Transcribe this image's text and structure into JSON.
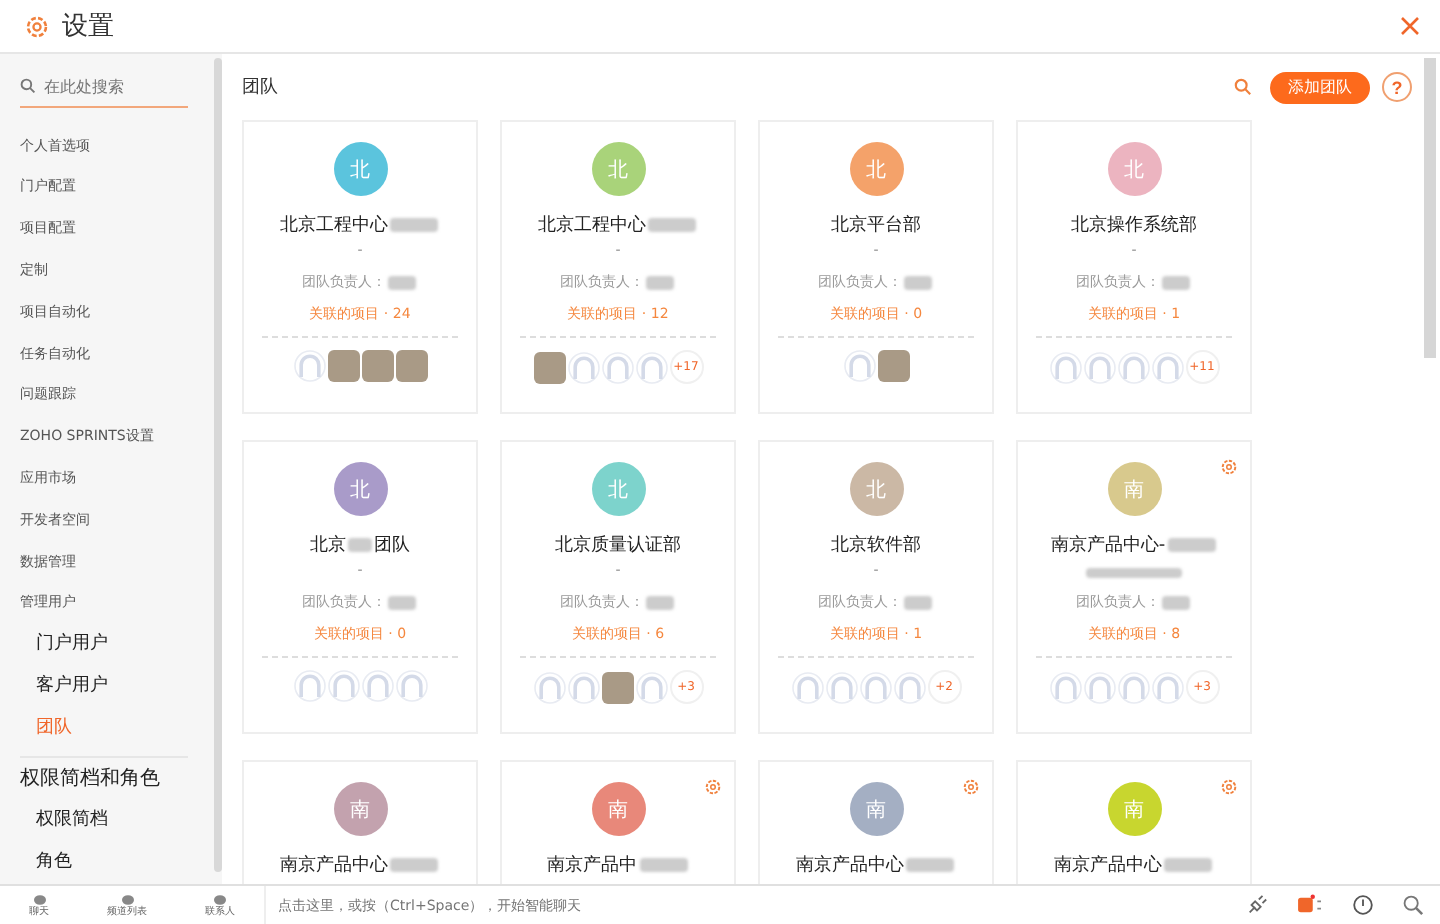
{
  "window": {
    "title": "设置"
  },
  "sidebar": {
    "search": {
      "placeholder": "在此处搜索"
    },
    "items": [
      {
        "kind": "item",
        "label": "个人首选项",
        "selected": false
      },
      {
        "kind": "item",
        "label": "门户配置",
        "selected": false
      },
      {
        "kind": "item",
        "label": "项目配置",
        "selected": false
      },
      {
        "kind": "item",
        "label": "定制",
        "selected": false
      },
      {
        "kind": "item",
        "label": "项目自动化",
        "selected": false
      },
      {
        "kind": "item",
        "label": "任务自动化",
        "selected": false
      },
      {
        "kind": "item",
        "label": "问题跟踪",
        "selected": false
      },
      {
        "kind": "item",
        "label": "ZOHO SPRINTS设置",
        "selected": false
      },
      {
        "kind": "item",
        "label": "应用市场",
        "selected": false
      },
      {
        "kind": "item",
        "label": "开发者空间",
        "selected": false
      },
      {
        "kind": "item",
        "label": "数据管理",
        "selected": false
      },
      {
        "kind": "item",
        "label": "管理用户",
        "selected": false
      },
      {
        "kind": "sub",
        "label": "门户用户",
        "selected": false
      },
      {
        "kind": "sub",
        "label": "客户用户",
        "selected": false
      },
      {
        "kind": "sub",
        "label": "团队",
        "selected": true
      },
      {
        "kind": "section",
        "label": "权限简档和角色",
        "selected": false
      },
      {
        "kind": "sub",
        "label": "权限简档",
        "selected": false
      },
      {
        "kind": "sub",
        "label": "角色",
        "selected": false
      }
    ]
  },
  "content": {
    "title": "团队",
    "add_button": "添加团队",
    "help_button": "?",
    "teams": [
      {
        "initial": "北",
        "color": "#5bc4dd",
        "name": "北京工程中心",
        "name_blurred": true,
        "description": "-",
        "leader_label": "团队负责人：",
        "projects": "关联的项目 · 24",
        "members": [
          {
            "kind": "empty"
          },
          {
            "kind": "photo"
          },
          {
            "kind": "photo"
          },
          {
            "kind": "photo"
          }
        ],
        "flagged": false
      },
      {
        "initial": "北",
        "color": "#a9d37a",
        "name": "北京工程中心",
        "name_blurred": true,
        "description": "-",
        "leader_label": "团队负责人：",
        "projects": "关联的项目 · 12",
        "members": [
          {
            "kind": "photo"
          },
          {
            "kind": "empty"
          },
          {
            "kind": "empty"
          },
          {
            "kind": "empty"
          }
        ],
        "more": "+17",
        "flagged": false
      },
      {
        "initial": "北",
        "color": "#f4a26a",
        "name": "北京平台部",
        "name_blurred": false,
        "description": "-",
        "leader_label": "团队负责人：",
        "projects": "关联的项目 · 0",
        "members": [
          {
            "kind": "empty"
          },
          {
            "kind": "photo"
          }
        ],
        "flagged": false
      },
      {
        "initial": "北",
        "color": "#ecb4c0",
        "name": "北京操作系统部",
        "name_blurred": false,
        "description": "-",
        "leader_label": "团队负责人：",
        "projects": "关联的项目 · 1",
        "members": [
          {
            "kind": "empty"
          },
          {
            "kind": "empty"
          },
          {
            "kind": "empty"
          },
          {
            "kind": "empty"
          }
        ],
        "more": "+11",
        "flagged": false
      },
      {
        "initial": "北",
        "color": "#a99bc9",
        "name": "北京",
        "name_tail": "团队",
        "description": "-",
        "leader_label": "团队负责人：",
        "projects": "关联的项目 · 0",
        "members": [
          {
            "kind": "empty"
          },
          {
            "kind": "empty"
          },
          {
            "kind": "empty"
          },
          {
            "kind": "empty"
          }
        ],
        "flagged": false
      },
      {
        "initial": "北",
        "color": "#7dd3cc",
        "name": "北京质量认证部",
        "name_blurred": false,
        "description": "-",
        "leader_label": "团队负责人：",
        "projects": "关联的项目 · 6",
        "members": [
          {
            "kind": "empty"
          },
          {
            "kind": "empty"
          },
          {
            "kind": "photo"
          },
          {
            "kind": "empty"
          }
        ],
        "more": "+3",
        "flagged": false
      },
      {
        "initial": "北",
        "color": "#cbb8a5",
        "name": "北京软件部",
        "name_blurred": false,
        "description": "-",
        "leader_label": "团队负责人：",
        "projects": "关联的项目 · 1",
        "members": [
          {
            "kind": "empty"
          },
          {
            "kind": "empty"
          },
          {
            "kind": "empty"
          },
          {
            "kind": "empty"
          }
        ],
        "more": "+2",
        "flagged": false
      },
      {
        "initial": "南",
        "color": "#d8c98d",
        "name": "南京产品中心-",
        "name_blurred": true,
        "description_blurred": true,
        "leader_label": "团队负责人：",
        "projects": "关联的项目 · 8",
        "members": [
          {
            "kind": "empty"
          },
          {
            "kind": "empty"
          },
          {
            "kind": "empty"
          },
          {
            "kind": "empty"
          }
        ],
        "more": "+3",
        "flagged": true
      },
      {
        "initial": "南",
        "color": "#c3a2ae",
        "name": "南京产品中心",
        "name_blurred": true,
        "flagged": false
      },
      {
        "initial": "南",
        "color": "#e8887a",
        "name": "南京产品中",
        "name_blurred": true,
        "flagged": true
      },
      {
        "initial": "南",
        "color": "#a4afc3",
        "name": "南京产品中心",
        "name_blurred": true,
        "flagged": true
      },
      {
        "initial": "南",
        "color": "#c8d62f",
        "name": "南京产品中心",
        "name_blurred": true,
        "flagged": true
      }
    ]
  },
  "bottom_bar": {
    "tabs": [
      "聊天",
      "频道列表",
      "联系人"
    ],
    "chat_placeholder": "点击这里，或按（Ctrl+Space），开始智能聊天"
  }
}
